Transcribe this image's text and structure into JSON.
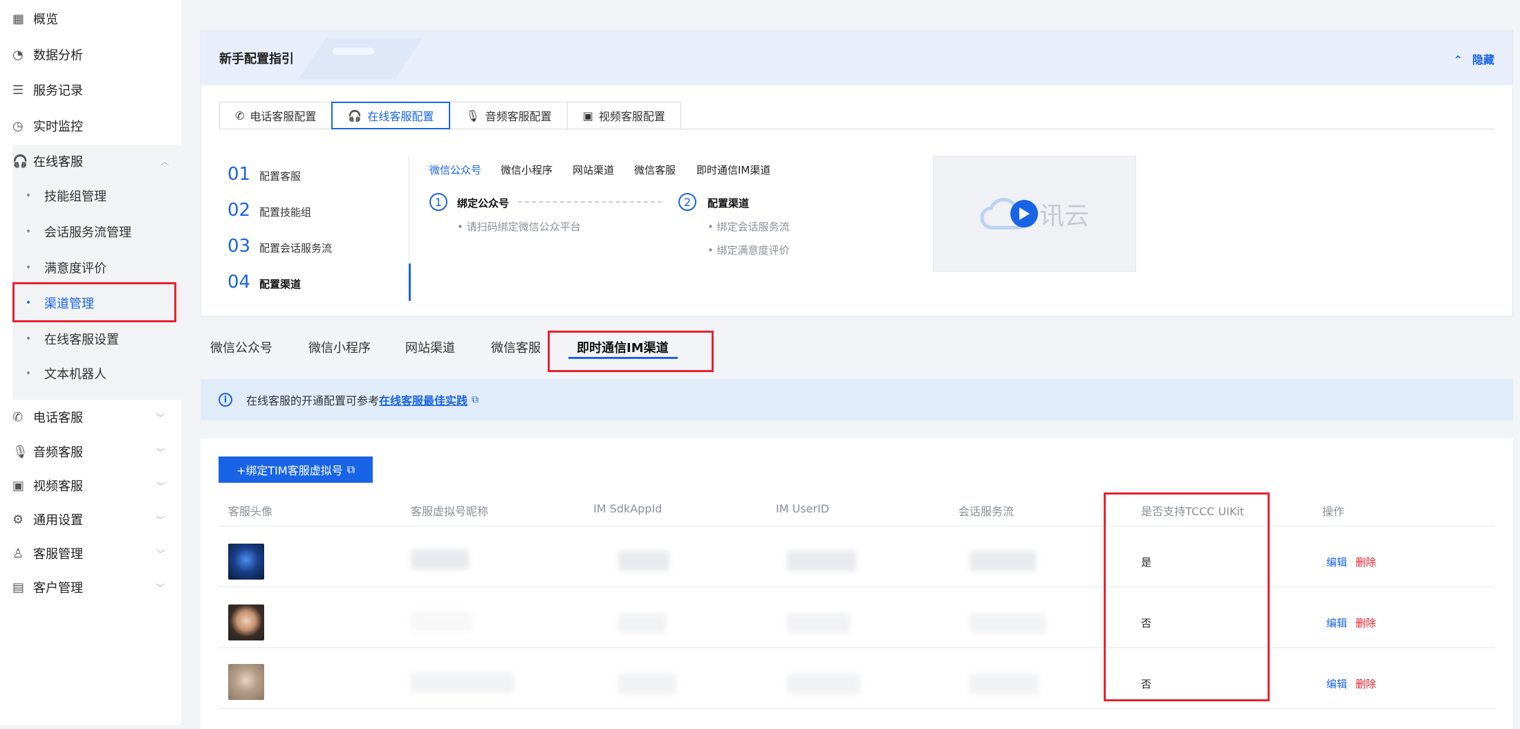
{
  "sidebar": {
    "items": [
      {
        "label": "概览",
        "icon": "grid-icon"
      },
      {
        "label": "数据分析",
        "icon": "chart-circle-icon"
      },
      {
        "label": "服务记录",
        "icon": "list-doc-icon"
      },
      {
        "label": "实时监控",
        "icon": "gauge-icon"
      },
      {
        "label": "在线客服",
        "icon": "headset-icon"
      }
    ],
    "subitems": [
      "技能组管理",
      "会话服务流管理",
      "满意度评价",
      "渠道管理",
      "在线客服设置",
      "文本机器人"
    ],
    "active_sub": "渠道管理",
    "lower_items": [
      {
        "label": "电话客服",
        "icon": "phone-icon"
      },
      {
        "label": "音频客服",
        "icon": "mic-icon"
      },
      {
        "label": "视频客服",
        "icon": "video-icon"
      },
      {
        "label": "通用设置",
        "icon": "settings-icon"
      },
      {
        "label": "客服管理",
        "icon": "user-icon"
      },
      {
        "label": "客户管理",
        "icon": "contact-card-icon"
      }
    ]
  },
  "guide": {
    "title": "新手配置指引",
    "hide_label": "隐藏",
    "config_tabs": [
      "电话客服配置",
      "在线客服配置",
      "音频客服配置",
      "视频客服配置"
    ],
    "active_config_tab": "在线客服配置",
    "steps": [
      {
        "num": "01",
        "label": "配置客服"
      },
      {
        "num": "02",
        "label": "配置技能组"
      },
      {
        "num": "03",
        "label": "配置会话服务流"
      },
      {
        "num": "04",
        "label": "配置渠道"
      }
    ],
    "channels": [
      "微信公众号",
      "微信小程序",
      "网站渠道",
      "微信客服",
      "即时通信IM渠道"
    ],
    "active_channel": "微信公众号",
    "substep1": {
      "num": "1",
      "title": "绑定公众号",
      "bullets": [
        "请扫码绑定微信公众平台"
      ]
    },
    "substep2": {
      "num": "2",
      "title": "配置渠道",
      "bullets": [
        "绑定会话服务流",
        "绑定满意度评价"
      ]
    },
    "video_brand": "讯云"
  },
  "page_tabs": [
    "微信公众号",
    "微信小程序",
    "网站渠道",
    "微信客服",
    "即时通信IM渠道"
  ],
  "active_page_tab": "即时通信IM渠道",
  "info": {
    "text": "在线客服的开通配置可参考",
    "link": "在线客服最佳实践"
  },
  "bind_button": "+绑定TIM客服虚拟号",
  "table": {
    "headers": [
      "客服头像",
      "客服虚拟号昵称",
      "IM SdkAppId",
      "IM UserID",
      "会话服务流",
      "是否支持TCCC UIKit",
      "操作"
    ],
    "rows": [
      {
        "uikit": "是",
        "edit": "编辑",
        "delete": "删除"
      },
      {
        "uikit": "否",
        "edit": "编辑",
        "delete": "删除"
      },
      {
        "uikit": "否",
        "edit": "编辑",
        "delete": "删除"
      }
    ]
  },
  "colors": {
    "accent": "#1964e6",
    "highlight_box": "#e8212e",
    "danger": "#e8212e"
  }
}
